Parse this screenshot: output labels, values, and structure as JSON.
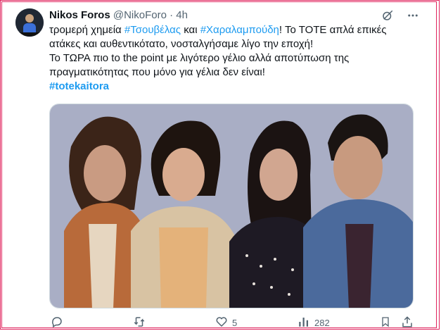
{
  "tweet": {
    "author_name": "Nikos Foros",
    "handle": "@NikoForo",
    "separator": "·",
    "time": "4h",
    "text_segments": {
      "l1_a": "τρομερή χημεία ",
      "l1_tag1": "#Τσουβέλας",
      "l1_b": " και ",
      "l1_tag2": "#Χαραλαμπούδη",
      "l1_c": "! Το ΤΟΤΕ απλά επικές",
      "l2": "ατάκες και αυθεντικότατο, νοσταλγήσαμε λίγο την εποχή!",
      "l3": "Το ΤΩΡΑ πιο to the point με λιγότερο γέλιο αλλά αποτύπωση της",
      "l4": "πραγματικότητας που μόνο για γέλια δεν είναι!",
      "l5_tag": "#totekaitora"
    }
  },
  "actions": {
    "reply_count": "",
    "retweet_count": "",
    "like_count": "5",
    "views_count": "282"
  },
  "icons": {
    "grok": "grok-icon",
    "more": "more-icon",
    "reply": "reply-icon",
    "retweet": "retweet-icon",
    "like": "like-icon",
    "views": "views-icon",
    "bookmark": "bookmark-icon",
    "share": "share-icon"
  },
  "colors": {
    "link": "#1d9bf0",
    "muted": "#536471",
    "text": "#0f1419",
    "frame": "#e0245e"
  }
}
